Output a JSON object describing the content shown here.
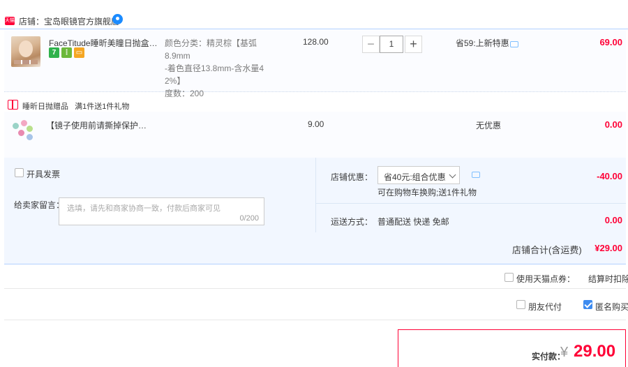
{
  "shop": {
    "badge_label": "天猫",
    "name": "店铺：宝岛眼镜官方旗舰店"
  },
  "item": {
    "title": "FaceTitude睡昕美瞳日抛盒10...",
    "tags": [
      "7",
      "⋮",
      "▭"
    ],
    "sku_line1": "颜色分类：精灵棕【基弧8.9mm",
    "sku_line2": "-着色直径13.8mm-含水量4",
    "sku_line3": "2%】",
    "sku_line4": "度数：200",
    "unit_price": "128.00",
    "quantity": "1",
    "qty_minus": "−",
    "qty_plus": "+",
    "promo": "省59:上新特惠",
    "amount": "69.00"
  },
  "gift_section": {
    "label": "睡昕日抛赠品",
    "rule": "满1件送1件礼物"
  },
  "gift_item": {
    "title": "【镜子使用前请撕掉保护膜】...",
    "unit_price": "9.00",
    "promo": "无优惠",
    "amount": "0.00"
  },
  "invoice": {
    "label": "开具发票"
  },
  "message": {
    "label": "给卖家留言：",
    "placeholder": "选填，请先和商家协商一致，付款后商家可见",
    "counter": "0/200"
  },
  "shop_discount": {
    "label": "店铺优惠：",
    "selected": "省40元:组合优惠",
    "note": "可在购物车换购;送1件礼物",
    "amount": "-40.00"
  },
  "shipping": {
    "label": "运送方式：",
    "method": "普通配送 快递 免邮",
    "amount": "0.00"
  },
  "shop_total": {
    "label": "店铺合计(含运费)",
    "amount": "¥29.00"
  },
  "coupon": {
    "label": "使用天猫点券：",
    "note": "结算时扣除"
  },
  "options": {
    "friend_pay_label": "朋友代付",
    "anonymous_label": "匿名购买",
    "anonymous_checked": true,
    "friend_pay_checked": false
  },
  "payment": {
    "label": "实付款：",
    "currency": "¥",
    "amount": "29.00"
  },
  "colors": {
    "accent_red": "#ff0036",
    "panel_blue": "#f2f7ff",
    "check_blue": "#3d8bf0"
  }
}
